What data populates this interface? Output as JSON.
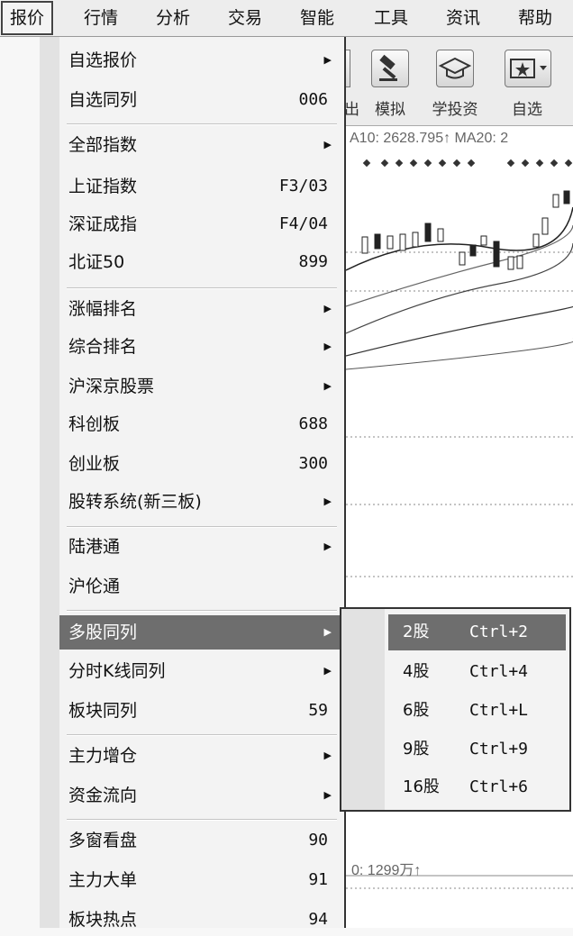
{
  "menubar": {
    "items": [
      "报价",
      "行情",
      "分析",
      "交易",
      "智能",
      "工具",
      "资讯",
      "帮助"
    ]
  },
  "toolbar": {
    "cut_label": "出",
    "items": [
      {
        "label": "模拟",
        "icon": "gavel-icon"
      },
      {
        "label": "学投资",
        "icon": "graduation-cap-icon"
      },
      {
        "label": "自选",
        "icon": "star-folder-icon"
      }
    ]
  },
  "chart": {
    "ma_text": "A10: 2628.795↑ MA20: 2",
    "ma_colors": {
      "k": "#222222",
      "grid": "#888888"
    },
    "vol_text": "0: 1299万↑"
  },
  "menu": {
    "items": [
      {
        "label": "自选报价",
        "submenu": true
      },
      {
        "label": "自选同列",
        "key": "006"
      },
      {
        "label": "全部指数",
        "submenu": true
      },
      {
        "label": "上证指数",
        "key": "F3/03"
      },
      {
        "label": "深证成指",
        "key": "F4/04"
      },
      {
        "label": "北证50",
        "key": "899"
      },
      {
        "label": "涨幅排名",
        "submenu": true
      },
      {
        "label": "综合排名",
        "submenu": true
      },
      {
        "label": "沪深京股票",
        "submenu": true
      },
      {
        "label": "科创板",
        "key": "688"
      },
      {
        "label": "创业板",
        "key": "300"
      },
      {
        "label": "股转系统(新三板)",
        "submenu": true
      },
      {
        "label": "陆港通",
        "submenu": true
      },
      {
        "label": "沪伦通"
      },
      {
        "label": "多股同列",
        "submenu": true,
        "highlighted": true
      },
      {
        "label": "分时K线同列",
        "submenu": true
      },
      {
        "label": "板块同列",
        "key": "59"
      },
      {
        "label": "主力增仓",
        "submenu": true
      },
      {
        "label": "资金流向",
        "submenu": true
      },
      {
        "label": "多窗看盘",
        "key": "90"
      },
      {
        "label": "主力大单",
        "key": "91"
      },
      {
        "label": "板块热点",
        "key": "94"
      }
    ],
    "arrow_glyph": "▶"
  },
  "submenu": {
    "items": [
      {
        "label": "2股",
        "key": "Ctrl+2",
        "highlighted": true
      },
      {
        "label": "4股",
        "key": "Ctrl+4"
      },
      {
        "label": "6股",
        "key": "Ctrl+L"
      },
      {
        "label": "9股",
        "key": "Ctrl+9"
      },
      {
        "label": "16股",
        "key": "Ctrl+6"
      }
    ]
  },
  "colors": {
    "highlight": "#6e6e6e",
    "menu_bg": "#f3f3f3"
  }
}
